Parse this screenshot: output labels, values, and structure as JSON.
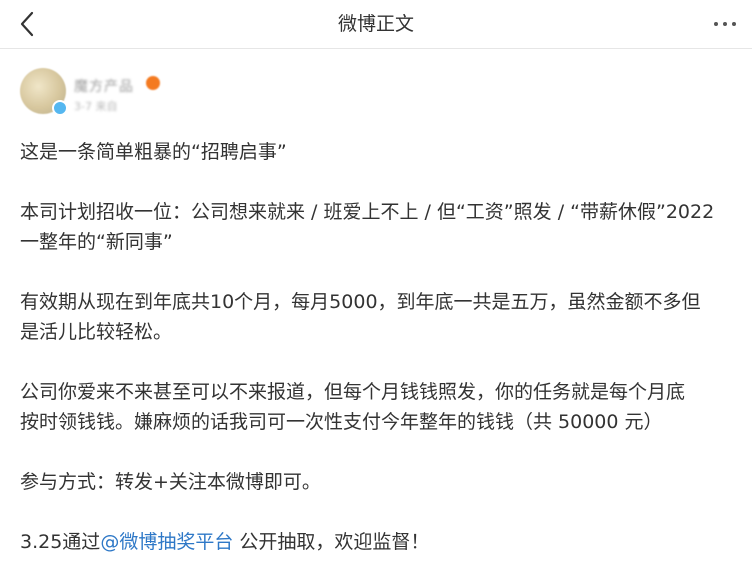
{
  "header": {
    "title": "微博正文",
    "back_icon": "chevron-left-icon",
    "more_icon": "more-horizontal-icon"
  },
  "author": {
    "name": "魔方产品",
    "meta": "3-7 来自"
  },
  "post": {
    "line1": "这是一条简单粗暴的“招聘启事”",
    "line2a": "本司计划招收一位：公司想来就来 / 班爱上不上 / 但“工资”照发 / “带薪休假”2022",
    "line2b": "一整年的“新同事”",
    "line3a": "有效期从现在到年底共10个月，每月5000，到年底一共是五万，虽然金额不多但",
    "line3b": "是活儿比较轻松。",
    "line4a": "公司你爱来不来甚至可以不来报道，但每个月钱钱照发，你的任务就是每个月底",
    "line4b": "按时领钱钱。嫌麻烦的话我司可一次性支付今年整年的钱钱（共 50000 元）",
    "line5": "参与方式：转发+关注本微博即可。",
    "line6_prefix": "3.25通过",
    "line6_mention": "@微博抽奖平台",
    "line6_suffix": " 公开抽取，欢迎监督！"
  },
  "colors": {
    "link": "#2e78c7",
    "text": "#333333",
    "divider": "#e6e6e6"
  }
}
